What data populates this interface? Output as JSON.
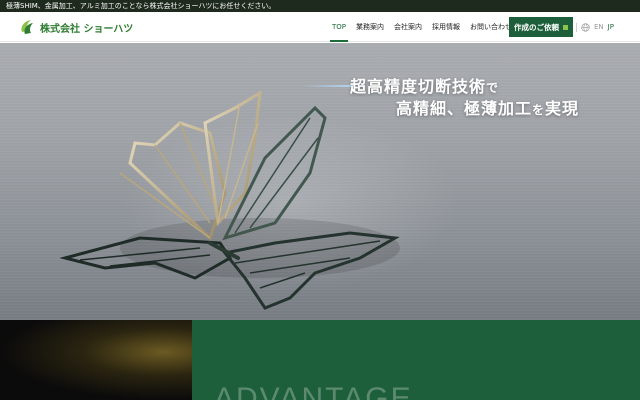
{
  "topbar": {
    "text": "極薄SHIM、金属加工、アルミ加工のことなら株式会社ショーハツにお任せください。"
  },
  "header": {
    "logo_text": "株式会社 ショーハツ",
    "nav": [
      {
        "label": "TOP",
        "active": true
      },
      {
        "label": "業務案内",
        "active": false
      },
      {
        "label": "会社案内",
        "active": false
      },
      {
        "label": "採用情報",
        "active": false
      },
      {
        "label": "お問い合わせ",
        "active": false
      }
    ],
    "cta_label": "作成のご依頼",
    "lang": {
      "en": "EN",
      "jp": "JP",
      "selected": "JP"
    }
  },
  "hero": {
    "line1_main": "超高精度切断技術",
    "line1_tail": "で",
    "line2_main": "高精細、極薄加工",
    "line2_tail": "を",
    "line2_end": "実現"
  },
  "advantage": {
    "heading": "ADVANTAGE"
  },
  "colors": {
    "brand_green": "#1d5e3b",
    "logo_green": "#2e7d32",
    "accent_lime": "#8bc34a",
    "topbar_bg": "#1f2a1f"
  },
  "icons": [
    "logo-mark-icon",
    "globe-icon",
    "cta-square-icon",
    "butterfly-illustration"
  ]
}
